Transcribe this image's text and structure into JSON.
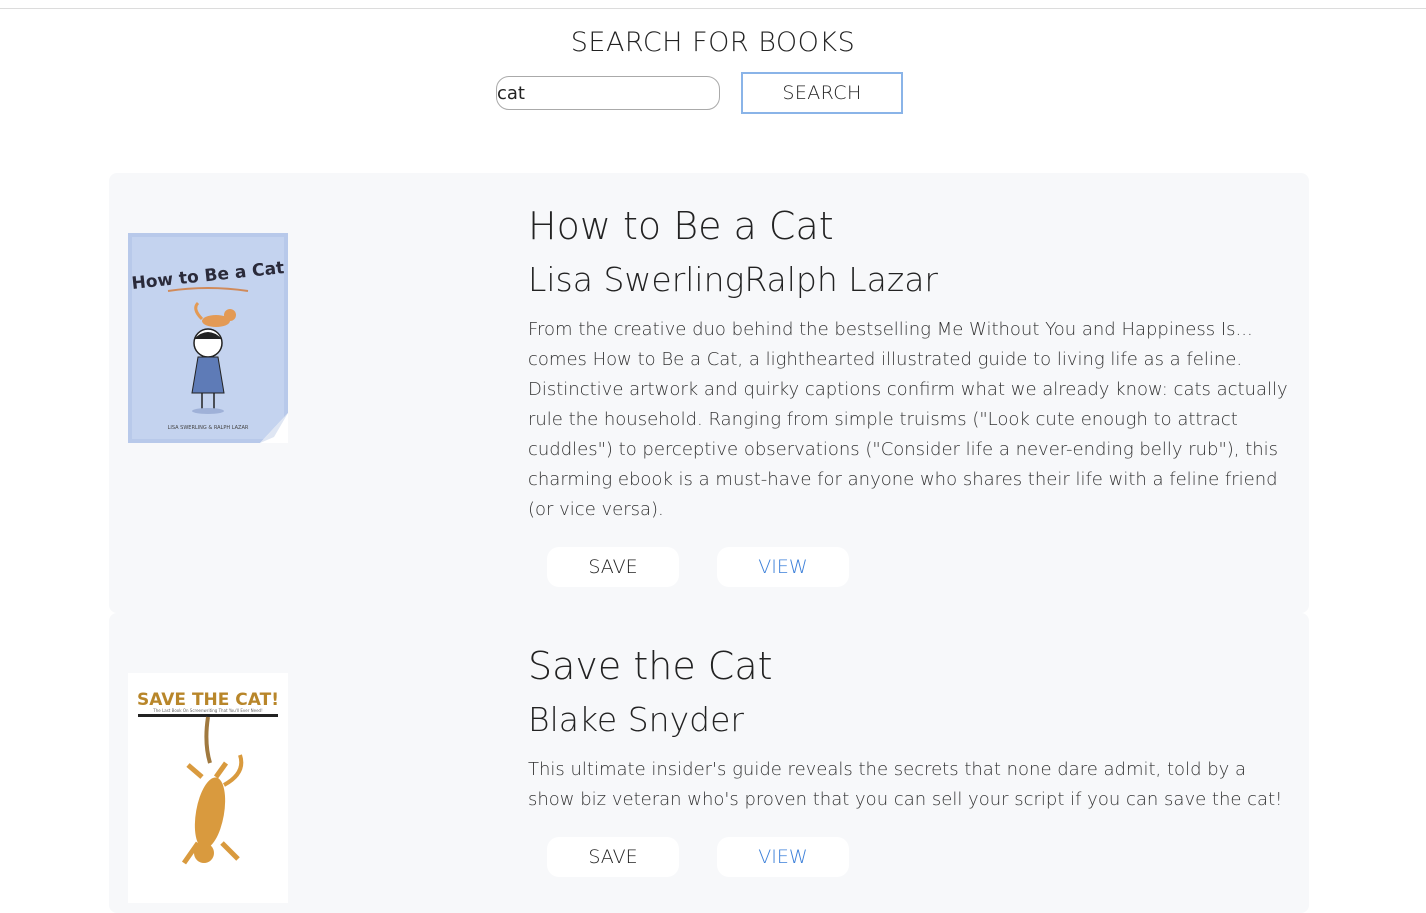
{
  "search": {
    "heading": "SEARCH FOR BOOKS",
    "query": "cat",
    "button_label": "SEARCH"
  },
  "results": [
    {
      "title": "How to Be a Cat",
      "authors": "Lisa SwerlingRalph Lazar",
      "description": "From the creative duo behind the bestselling Me Without You and Happiness Is... comes How to Be a Cat, a lighthearted illustrated guide to living life as a feline. Distinctive artwork and quirky captions confirm what we already know: cats actually rule the household. Ranging from simple truisms (\"Look cute enough to attract cuddles\") to perceptive observations (\"Consider life a never-ending belly rub\"), this charming ebook is a must-have for anyone who shares their life with a feline friend (or vice versa).",
      "cover_text": "How to Be a Cat",
      "cover_caption": "LISA SWERLING & RALPH LAZAR",
      "save_label": "SAVE",
      "view_label": "VIEW"
    },
    {
      "title": "Save the Cat",
      "authors": "Blake Snyder",
      "description": "This ultimate insider's guide reveals the secrets that none dare admit, told by a show biz veteran who's proven that you can sell your script if you can save the cat!",
      "cover_text": "SAVE THE CAT!",
      "cover_caption": "The Last Book On Screenwriting That You'll Ever Need!",
      "save_label": "SAVE",
      "view_label": "VIEW"
    }
  ],
  "colors": {
    "card_background": "#f7f8fa",
    "search_button_border": "#8ab4e8",
    "view_link": "#3b7fd9",
    "cover1_background": "#b8c9ea",
    "cover2_title": "#b8862a"
  }
}
